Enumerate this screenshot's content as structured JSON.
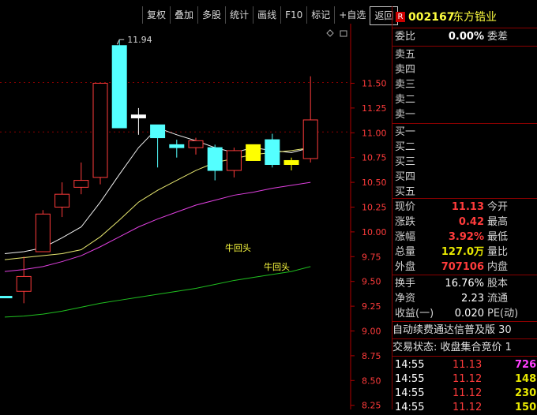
{
  "toolbar": {
    "items": [
      "复权",
      "叠加",
      "多股",
      "统计",
      "画线",
      "F10",
      "标记",
      "+自选",
      "返回"
    ]
  },
  "chart": {
    "price_labels": [
      "11.50",
      "11.25",
      "11.00",
      "10.75",
      "10.50",
      "10.25",
      "10.00",
      "9.75",
      "9.50",
      "9.25",
      "9.00",
      "8.75",
      "8.50",
      "8.25"
    ],
    "high_marker": "11.94",
    "annotations": [
      "牛回头",
      "牛回头"
    ]
  },
  "chart_data": {
    "type": "candlestick",
    "yaxis_ticks": [
      11.5,
      11.25,
      11.0,
      10.75,
      10.5,
      10.25,
      10.0,
      9.75,
      9.5,
      9.25,
      9.0,
      8.75,
      8.5,
      8.25
    ],
    "candles": [
      {
        "open": 9.35,
        "close": 9.35,
        "high": 9.35,
        "low": 9.35,
        "color": "cyan"
      },
      {
        "open": 9.4,
        "close": 9.55,
        "high": 9.75,
        "low": 9.28,
        "color": "red"
      },
      {
        "open": 9.8,
        "close": 10.18,
        "high": 10.22,
        "low": 9.8,
        "color": "red"
      },
      {
        "open": 10.25,
        "close": 10.38,
        "high": 10.5,
        "low": 10.15,
        "color": "red"
      },
      {
        "open": 10.45,
        "close": 10.52,
        "high": 10.7,
        "low": 10.38,
        "color": "red"
      },
      {
        "open": 10.55,
        "close": 11.5,
        "high": 11.5,
        "low": 10.48,
        "color": "red"
      },
      {
        "open": 11.88,
        "close": 11.05,
        "high": 11.94,
        "low": 11.05,
        "color": "cyan"
      },
      {
        "open": 11.18,
        "close": 11.15,
        "high": 11.25,
        "low": 10.98,
        "color": "white"
      },
      {
        "open": 11.08,
        "close": 10.95,
        "high": 11.08,
        "low": 10.65,
        "color": "cyan"
      },
      {
        "open": 10.88,
        "close": 10.85,
        "high": 10.93,
        "low": 10.75,
        "color": "cyan"
      },
      {
        "open": 10.85,
        "close": 10.92,
        "high": 10.95,
        "low": 10.78,
        "color": "red"
      },
      {
        "open": 10.85,
        "close": 10.62,
        "high": 10.88,
        "low": 10.52,
        "color": "cyan"
      },
      {
        "open": 10.62,
        "close": 10.82,
        "high": 10.85,
        "low": 10.55,
        "color": "red"
      },
      {
        "open": 10.72,
        "close": 10.88,
        "high": 10.88,
        "low": 10.72,
        "color": "yellow"
      },
      {
        "open": 10.93,
        "close": 10.68,
        "high": 10.99,
        "low": 10.65,
        "color": "cyan"
      },
      {
        "open": 10.72,
        "close": 10.68,
        "high": 10.75,
        "low": 10.62,
        "color": "yellow"
      },
      {
        "open": 10.74,
        "close": 11.13,
        "high": 11.57,
        "low": 10.7,
        "color": "red"
      }
    ],
    "ma_series": [
      {
        "color": "white",
        "values": [
          9.78,
          9.8,
          9.84,
          9.94,
          10.05,
          10.3,
          10.58,
          10.85,
          11.05,
          10.98,
          10.92,
          10.85,
          10.8,
          10.85,
          10.82,
          10.8,
          10.85
        ]
      },
      {
        "color": "yellow",
        "values": [
          9.72,
          9.74,
          9.76,
          9.78,
          9.82,
          9.95,
          10.12,
          10.3,
          10.42,
          10.52,
          10.62,
          10.7,
          10.74,
          10.78,
          10.8,
          10.82,
          10.85
        ]
      },
      {
        "color": "magenta",
        "values": [
          9.6,
          9.62,
          9.65,
          9.7,
          9.76,
          9.85,
          9.95,
          10.05,
          10.13,
          10.2,
          10.27,
          10.32,
          10.37,
          10.4,
          10.44,
          10.47,
          10.5
        ]
      },
      {
        "color": "green",
        "values": [
          9.14,
          9.15,
          9.17,
          9.2,
          9.24,
          9.28,
          9.31,
          9.34,
          9.37,
          9.4,
          9.43,
          9.47,
          9.51,
          9.54,
          9.57,
          9.6,
          9.65
        ]
      }
    ]
  },
  "panel": {
    "stock_code": "002167",
    "stock_name": "东方锆业",
    "r_badge": "R",
    "weibi_label": "委比",
    "weibi_value": "0.00%",
    "weicha_label": "委差",
    "sell": [
      "卖五",
      "卖四",
      "卖三",
      "卖二",
      "卖一"
    ],
    "buy": [
      "买一",
      "买二",
      "买三",
      "买四",
      "买五"
    ],
    "quote_rows": [
      {
        "l1": "现价",
        "v1": "11.13",
        "c1": "red",
        "l2": "今开"
      },
      {
        "l1": "涨跌",
        "v1": "0.42",
        "c1": "red",
        "l2": "最高"
      },
      {
        "l1": "涨幅",
        "v1": "3.92%",
        "c1": "red",
        "l2": "最低"
      },
      {
        "l1": "总量",
        "v1": "127.0万",
        "c1": "yellow",
        "l2": "量比"
      },
      {
        "l1": "外盘",
        "v1": "707106",
        "c1": "red",
        "l2": "内盘"
      }
    ],
    "fin_rows": [
      {
        "l1": "换手",
        "v1": "16.76%",
        "l2": "股本"
      },
      {
        "l1": "净资",
        "v1": "2.23",
        "l2": "流通"
      },
      {
        "l1": "收益(一)",
        "v1": "0.020",
        "l2": "PE(动)"
      }
    ],
    "ad_text": "自动续费通达信普及版 30",
    "status_text": "交易状态: 收盘集合竞价 1",
    "trades": [
      {
        "time": "14:55",
        "price": "11.13",
        "vol": "726",
        "vcolor": "magenta"
      },
      {
        "time": "14:55",
        "price": "11.12",
        "vol": "148",
        "vcolor": "yellow"
      },
      {
        "time": "14:55",
        "price": "11.12",
        "vol": "230",
        "vcolor": "yellow"
      },
      {
        "time": "14:55",
        "price": "11.12",
        "vol": "150",
        "vcolor": "yellow"
      }
    ]
  }
}
